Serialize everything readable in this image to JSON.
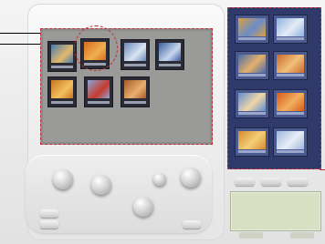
{
  "app": {
    "name": "photo-browser-device-mockup"
  },
  "colors": {
    "callout_accent": "#c0303a",
    "gallery_background": "#9a9a98",
    "sidebar_background": "#2f3a6a",
    "display_background": "#d7e0c2"
  },
  "gallery": {
    "thumbnails": [
      {
        "id": "photo-1",
        "tone": "#4a7ab0",
        "accent": "#e2b96b"
      },
      {
        "id": "photo-2",
        "tone": "#d86a1c",
        "accent": "#f0b050"
      },
      {
        "id": "photo-3",
        "tone": "#6b86b8",
        "accent": "#d9e4f2"
      },
      {
        "id": "photo-4",
        "tone": "#3a5f9e",
        "accent": "#c9d7ee"
      },
      {
        "id": "photo-5",
        "tone": "#c9761e",
        "accent": "#f3c060"
      },
      {
        "id": "photo-6",
        "tone": "#8aa6d6",
        "accent": "#c63a2c"
      },
      {
        "id": "photo-7",
        "tone": "#a85a2a",
        "accent": "#e8b070"
      }
    ]
  },
  "sidebar": {
    "thumbnails": [
      {
        "id": "side-1",
        "tone": "#d9a040",
        "accent": "#6b8cc9"
      },
      {
        "id": "side-2",
        "tone": "#8fb2dd",
        "accent": "#e4ecf7"
      },
      {
        "id": "side-3",
        "tone": "#4a6aa9",
        "accent": "#e3b06a"
      },
      {
        "id": "side-4",
        "tone": "#c96a2b",
        "accent": "#f1c07a"
      },
      {
        "id": "side-5",
        "tone": "#5f8ccf",
        "accent": "#f0d6a8"
      },
      {
        "id": "side-6",
        "tone": "#d65a1a",
        "accent": "#f2b060"
      },
      {
        "id": "side-7",
        "tone": "#d78a2e",
        "accent": "#f3cf78"
      },
      {
        "id": "side-8",
        "tone": "#9fb7db",
        "accent": "#e8eef7"
      }
    ]
  },
  "icons": {
    "knob": "circle-knob-icon",
    "pill": "pill-button-icon"
  }
}
